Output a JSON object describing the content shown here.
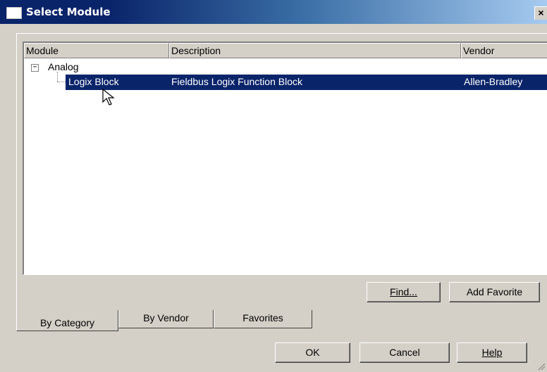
{
  "window": {
    "title": "Select Module",
    "close_label": "×"
  },
  "list": {
    "columns": [
      "Module",
      "Description",
      "Vendor"
    ],
    "tree": {
      "toggle": "−",
      "group": "Analog",
      "rows": [
        {
          "module": "Logix Block",
          "description": "Fieldbus Logix Function Block",
          "vendor": "Allen-Bradley",
          "selected": true
        }
      ]
    }
  },
  "panel_buttons": {
    "find_label": "Find...",
    "add_favorite_label": "Add Favorite"
  },
  "tabs": [
    {
      "label": "By Category",
      "active": true
    },
    {
      "label": "By Vendor",
      "active": false
    },
    {
      "label": "Favorites",
      "active": false
    }
  ],
  "dialog_buttons": {
    "ok_label": "OK",
    "cancel_label": "Cancel",
    "help_label": "Help"
  },
  "colors": {
    "face": "#d4d0c8",
    "title_active": "#0a246a",
    "selection": "#0a246a"
  },
  "icons": [
    "window-icon",
    "close-icon",
    "tree-collapse-icon",
    "mouse-pointer-icon",
    "resize-grip-icon"
  ]
}
